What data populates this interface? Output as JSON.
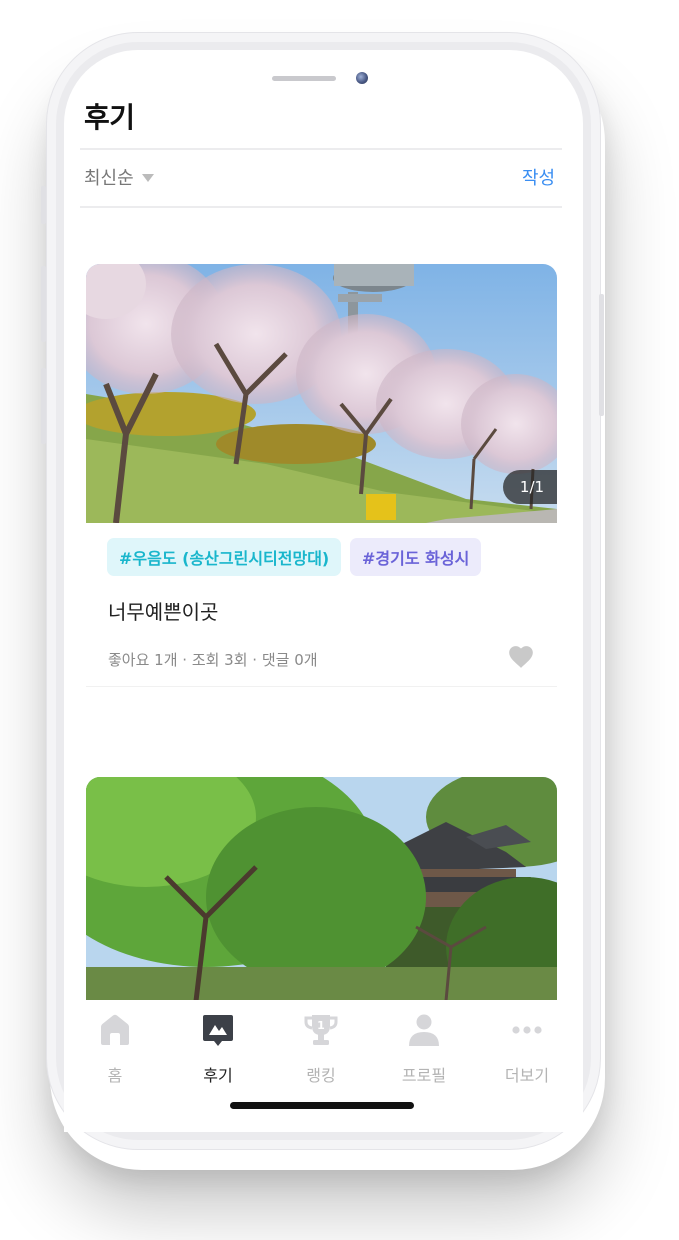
{
  "header": {
    "title": "후기"
  },
  "toolbar": {
    "sort_label": "최신순",
    "write_label": "작성"
  },
  "reviews": [
    {
      "image_counter": "1/1",
      "tags": [
        "#우음도 (송산그린시티전망대)",
        "#경기도 화성시"
      ],
      "title": "너무예쁜이곳",
      "stats": "좋아요 1개 · 조회 3회 · 댓글 0개"
    }
  ],
  "tabbar": {
    "items": [
      {
        "label": "홈",
        "icon": "home-icon"
      },
      {
        "label": "후기",
        "icon": "review-icon",
        "active": true
      },
      {
        "label": "랭킹",
        "icon": "trophy-icon"
      },
      {
        "label": "프로필",
        "icon": "person-icon"
      },
      {
        "label": "더보기",
        "icon": "more-icon"
      }
    ]
  },
  "colors": {
    "accent_blue": "#3a8ef2",
    "tag_cyan_text": "#19b6cc",
    "tag_cyan_bg": "#dff6fa",
    "tag_purple_text": "#6a63d8",
    "tag_purple_bg": "#ecebfb",
    "tab_active": "#222222",
    "tab_inactive": "#b4b4b4"
  }
}
